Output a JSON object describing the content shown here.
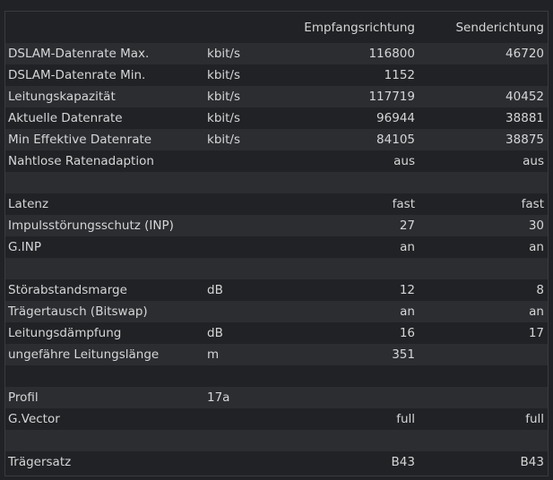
{
  "header": {
    "col_down": "Empfangsrichtung",
    "col_up": "Senderichtung"
  },
  "rows": [
    {
      "label": "DSLAM-Datenrate Max.",
      "unit": "kbit/s",
      "down": "116800",
      "up": "46720"
    },
    {
      "label": "DSLAM-Datenrate Min.",
      "unit": "kbit/s",
      "down": "1152",
      "up": ""
    },
    {
      "label": "Leitungskapazität",
      "unit": "kbit/s",
      "down": "117719",
      "up": "40452"
    },
    {
      "label": "Aktuelle Datenrate",
      "unit": "kbit/s",
      "down": "96944",
      "up": "38881"
    },
    {
      "label": "Min Effektive Datenrate",
      "unit": "kbit/s",
      "down": "84105",
      "up": "38875"
    },
    {
      "label": "Nahtlose Ratenadaption",
      "unit": "",
      "down": "aus",
      "up": "aus"
    },
    {
      "label": "",
      "unit": "",
      "down": "",
      "up": ""
    },
    {
      "label": "Latenz",
      "unit": "",
      "down": "fast",
      "up": "fast"
    },
    {
      "label": "Impulsstörungsschutz (INP)",
      "unit": "",
      "down": "27",
      "up": "30"
    },
    {
      "label": "G.INP",
      "unit": "",
      "down": "an",
      "up": "an"
    },
    {
      "label": "",
      "unit": "",
      "down": "",
      "up": ""
    },
    {
      "label": "Störabstandsmarge",
      "unit": "dB",
      "down": "12",
      "up": "8"
    },
    {
      "label": "Trägertausch (Bitswap)",
      "unit": "",
      "down": "an",
      "up": "an"
    },
    {
      "label": "Leitungsdämpfung",
      "unit": "dB",
      "down": "16",
      "up": "17"
    },
    {
      "label": "ungefähre Leitungslänge",
      "unit": "m",
      "down": "351",
      "up": ""
    },
    {
      "label": "",
      "unit": "",
      "down": "",
      "up": ""
    },
    {
      "label": "Profil",
      "unit": "17a",
      "down": "",
      "up": ""
    },
    {
      "label": "G.Vector",
      "unit": "",
      "down": "full",
      "up": "full"
    },
    {
      "label": "",
      "unit": "",
      "down": "",
      "up": ""
    },
    {
      "label": "Trägersatz",
      "unit": "",
      "down": "B43",
      "up": "B43"
    }
  ]
}
